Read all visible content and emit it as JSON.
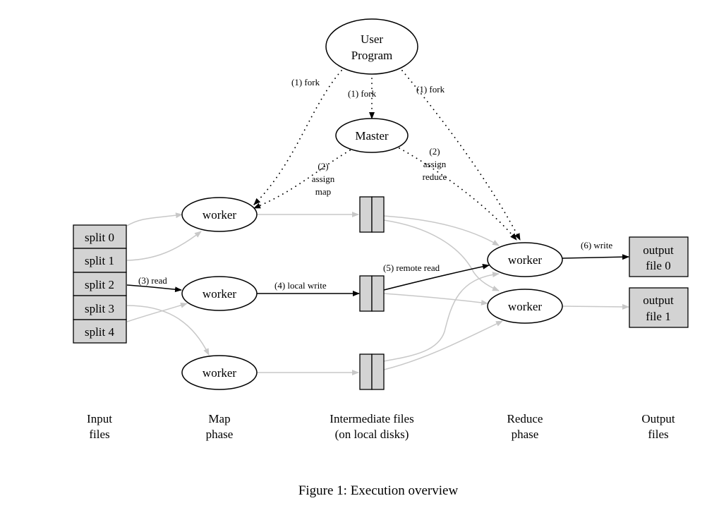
{
  "nodes": {
    "user_program": [
      "User",
      "Program"
    ],
    "master": "Master",
    "map_workers": [
      "worker",
      "worker",
      "worker"
    ],
    "reduce_workers": [
      "worker",
      "worker"
    ],
    "splits": [
      "split 0",
      "split 1",
      "split 2",
      "split 3",
      "split 4"
    ],
    "outputs": [
      [
        "output",
        "file 0"
      ],
      [
        "output",
        "file 1"
      ]
    ]
  },
  "edge_labels": {
    "fork_left": "(1) fork",
    "fork_center": "(1) fork",
    "fork_right": "(1) fork",
    "assign_map": [
      "(2)",
      "assign",
      "map"
    ],
    "assign_reduce": [
      "(2)",
      "assign",
      "reduce"
    ],
    "read": "(3) read",
    "local_write": "(4) local write",
    "remote_read": "(5) remote read",
    "write": "(6) write"
  },
  "phases": [
    [
      "Input",
      "files"
    ],
    [
      "Map",
      "phase"
    ],
    [
      "Intermediate files",
      "(on local disks)"
    ],
    [
      "Reduce",
      "phase"
    ],
    [
      "Output",
      "files"
    ]
  ],
  "caption": "Figure 1: Execution overview",
  "colors": {
    "box_fill": "#d3d3d3",
    "gray_edge": "#c8c8c8",
    "black": "#000000"
  }
}
